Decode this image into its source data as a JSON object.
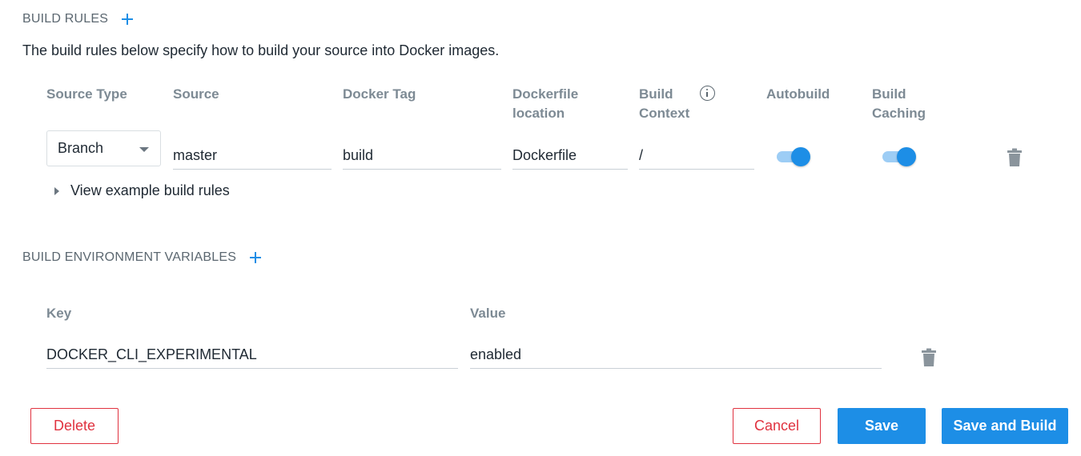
{
  "build_rules": {
    "heading": "BUILD RULES",
    "description": "The build rules below specify how to build your source into Docker images.",
    "columns": {
      "source_type": "Source Type",
      "source": "Source",
      "docker_tag": "Docker Tag",
      "dockerfile_location": "Dockerfile location",
      "build_context": "Build Context",
      "autobuild": "Autobuild",
      "build_caching": "Build Caching"
    },
    "rule": {
      "source_type": "Branch",
      "source": "master",
      "docker_tag": "build",
      "dockerfile_location": "Dockerfile",
      "build_context": "/",
      "autobuild": true,
      "build_caching": true
    },
    "example_link": "View example build rules"
  },
  "env_vars": {
    "heading": "BUILD ENVIRONMENT VARIABLES",
    "columns": {
      "key": "Key",
      "value": "Value"
    },
    "items": [
      {
        "key": "DOCKER_CLI_EXPERIMENTAL",
        "value": "enabled"
      }
    ]
  },
  "actions": {
    "delete": "Delete",
    "cancel": "Cancel",
    "save": "Save",
    "save_and_build": "Save and Build"
  },
  "icons": {
    "add": "plus-icon",
    "info": "info-icon",
    "delete": "trash-icon",
    "dropdown": "caret-down-icon",
    "disclosure": "triangle-right-icon"
  },
  "colors": {
    "accent": "#1d8ee6",
    "danger": "#e0323f"
  }
}
